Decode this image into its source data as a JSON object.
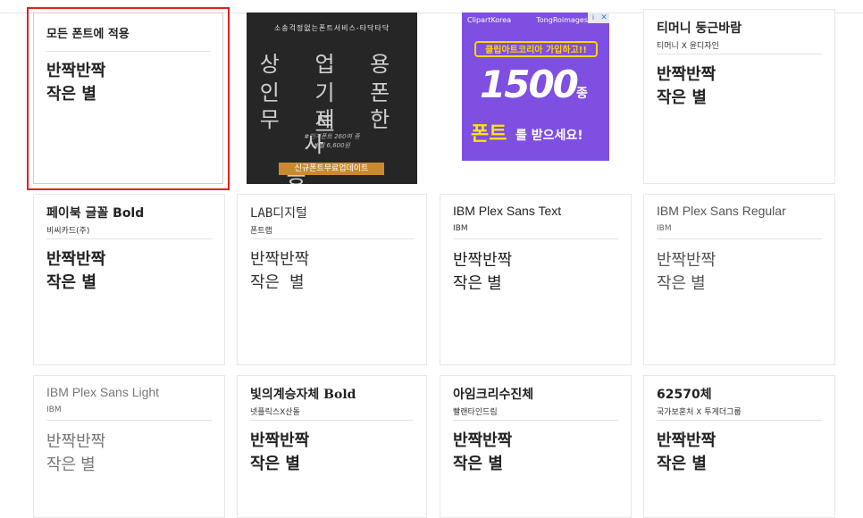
{
  "apply_card": {
    "title": "모든 폰트에 적용",
    "sample_line1": "반짝반짝",
    "sample_line2": "작은 별"
  },
  "ad1": {
    "top_text": "소송걱정없는폰트서비스-타닥타닥",
    "lines": [
      "상 업 용",
      "인 기 폰 트",
      "무 제 한",
      "사 용"
    ],
    "fine1": "#인기폰트 260여 종",
    "fine2": "#월 6,600원",
    "cta": "신규폰트무료업데이트"
  },
  "ad2": {
    "brand": "ClipartKorea",
    "brand2": "TongRoimages",
    "headline": "클립아트코리아 가입하고!!",
    "number": "1500",
    "unit": "종",
    "cta_strong": "폰트",
    "cta_rest": "를 받으세요!",
    "close_icon": "close-icon",
    "info_icon": "info-icon"
  },
  "cards": [
    {
      "title": "티머니 둥근바람",
      "sub": "티머니 X 윤디자인",
      "sample1": "반짝반짝",
      "sample2": "작은 별"
    },
    {
      "title": "페이북 글꼴 Bold",
      "sub": "비씨카드(주)",
      "sample1": "반짝반짝",
      "sample2": "작은 별"
    },
    {
      "title": "LAB디지털",
      "sub": "폰트랩",
      "sample1": "반짝반짝",
      "sample2": "작은 별"
    },
    {
      "title": "IBM Plex Sans Text",
      "sub": "IBM",
      "sample1": "반짝반짝",
      "sample2": "작은 별"
    },
    {
      "title": "IBM Plex Sans Regular",
      "sub": "IBM",
      "sample1": "반짝반짝",
      "sample2": "작은 별"
    },
    {
      "title": "IBM Plex Sans Light",
      "sub": "IBM",
      "sample1": "반짝반짝",
      "sample2": "작은 별"
    },
    {
      "title": "빛의계승자체 Bold",
      "sub": "넷플릭스X산돌",
      "sample1": "반짝반짝",
      "sample2": "작은 별"
    },
    {
      "title": "아임크리수진체",
      "sub": "빨랜타인드림",
      "sample1": "반짝반짝",
      "sample2": "작은 별"
    },
    {
      "title": "62570체",
      "sub": "국가보훈처 X 투게더그룹",
      "sample1": "반짝반짝",
      "sample2": "작은 별"
    }
  ]
}
